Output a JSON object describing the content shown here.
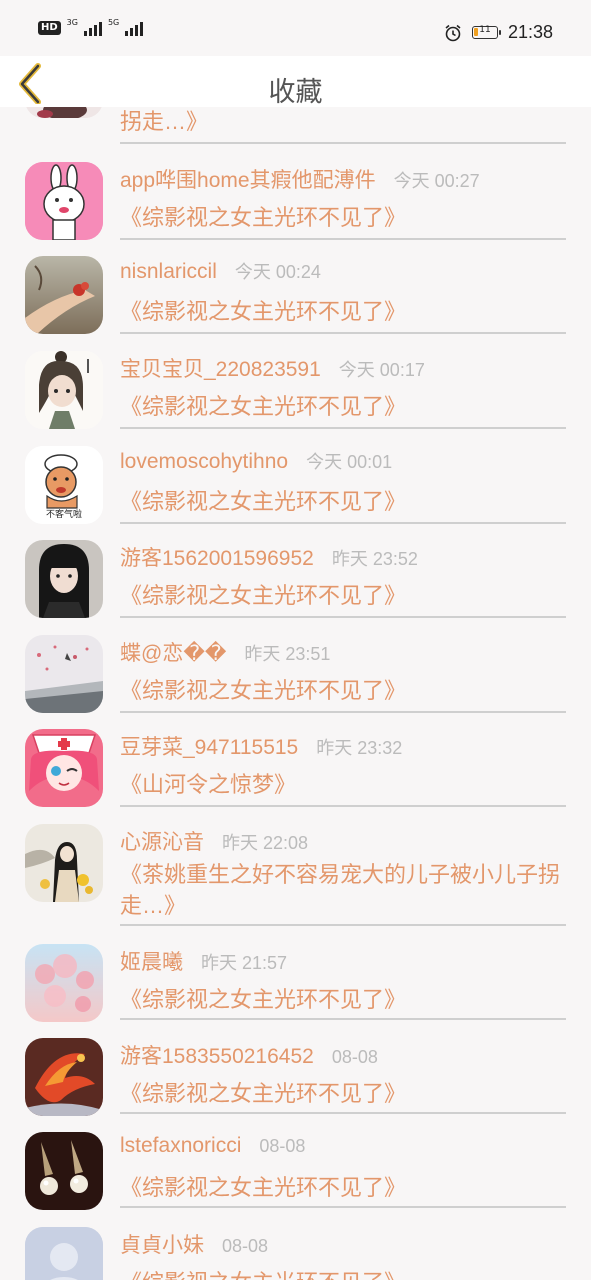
{
  "status_bar": {
    "hd": "HD",
    "net1": "3G",
    "net2": "5G",
    "battery": "11",
    "time": "21:38"
  },
  "header": {
    "title": "收藏"
  },
  "top_partial_book": "拐走…》",
  "items": [
    {
      "name": "app哗围home其瘕他配溥件",
      "time": "今天 00:27",
      "book": "《综影视之女主光环不见了》",
      "avatar": "cartoon-bunny-avatar"
    },
    {
      "name": "nisnlariccil",
      "time": "今天 00:24",
      "book": "《综影视之女主光环不见了》",
      "avatar": "hand-flower-photo-avatar"
    },
    {
      "name": "宝贝宝贝_220823591",
      "time": "今天 00:17",
      "book": "《综影视之女主光环不见了》",
      "avatar": "anime-girl-sketch-avatar"
    },
    {
      "name": "lovemoscohytihno",
      "time": "今天 00:01",
      "book": "《综影视之女主光环不见了》",
      "avatar": "meme-cartoon-avatar",
      "avatar_caption": "不客气啦"
    },
    {
      "name": "游客1562001596952",
      "time": "昨天 23:52",
      "book": "《综影视之女主光环不见了》",
      "avatar": "girl-photo-avatar"
    },
    {
      "name": "蝶@恋��",
      "time": "昨天 23:51",
      "book": "《综影视之女主光环不见了》",
      "avatar": "scenery-photo-avatar"
    },
    {
      "name": "豆芽菜_947115515",
      "time": "昨天 23:32",
      "book": "《山河令之惊梦》",
      "avatar": "anime-nurse-avatar"
    },
    {
      "name": "心源沁音",
      "time": "昨天 22:08",
      "book": "《茶姚重生之好不容易宠大的儿子被小儿子拐走…》",
      "avatar": "ancient-painting-avatar"
    },
    {
      "name": "姬晨曦",
      "time": "昨天 21:57",
      "book": "《综影视之女主光环不见了》",
      "avatar": "pink-blossom-avatar"
    },
    {
      "name": "游客1583550216452",
      "time": "08-08",
      "book": "《综影视之女主光环不见了》",
      "avatar": "phoenix-avatar"
    },
    {
      "name": "lstefaxnoricci",
      "time": "08-08",
      "book": "《综影视之女主光环不见了》",
      "avatar": "earrings-photo-avatar"
    },
    {
      "name": "貞貞小妹",
      "time": "08-08",
      "book": "《综影视之女主光环不见了》",
      "avatar": "default-user-avatar"
    }
  ]
}
